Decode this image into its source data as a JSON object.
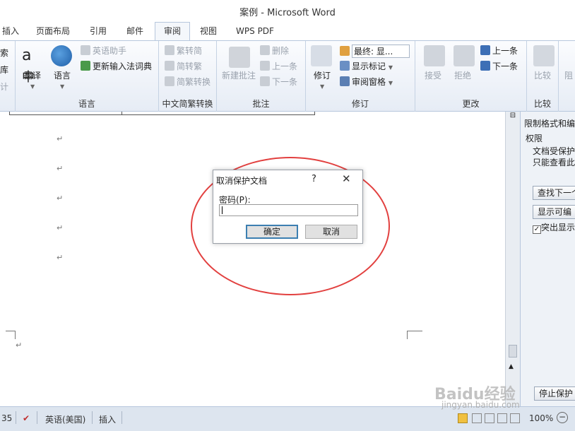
{
  "window": {
    "title": "案例 - Microsoft Word"
  },
  "tabs": [
    "插入",
    "页面布局",
    "引用",
    "邮件",
    "审阅",
    "视图",
    "WPS PDF"
  ],
  "active_tab": "审阅",
  "ribbon": {
    "left_partial": [
      "索",
      "库",
      "计"
    ],
    "language": {
      "label": "语言",
      "translate": "翻译",
      "language_btn": "语言",
      "english_assistant": "英语助手",
      "update_ime": "更新输入法词典"
    },
    "chinese_convert": {
      "label": "中文简繁转换",
      "to_traditional": "繁转简",
      "to_simplified": "简转繁",
      "convert": "简繁转换"
    },
    "comments": {
      "label": "批注",
      "new_comment": "新建批注",
      "delete": "删除",
      "previous": "上一条",
      "next": "下一条"
    },
    "tracking": {
      "label": "修订",
      "track_changes": "修订",
      "final_display": "最终: 显...",
      "show_markup": "显示标记",
      "reviewing_pane": "审阅窗格"
    },
    "changes": {
      "label": "更改",
      "accept": "接受",
      "reject": "拒绝",
      "previous": "上一条",
      "next": "下一条"
    },
    "compare": {
      "label": "比较",
      "compare_btn": "比较"
    },
    "protect_partial": "阻"
  },
  "side_pane": {
    "title": "限制格式和编辑",
    "section": "权限",
    "line1": "文档受保护",
    "line2": "只能查看此",
    "find_next": "查找下一个",
    "show_editable": "显示可编",
    "highlight": "突出显示",
    "stop_protection": "停止保护"
  },
  "dialog": {
    "title": "取消保护文档",
    "help": "?",
    "close": "✕",
    "password_label": "密码(P):",
    "password_value": "",
    "ok": "确定",
    "cancel": "取消"
  },
  "status": {
    "page_partial": "35",
    "language": "英语(美国)",
    "mode": "插入",
    "zoom": "100%"
  },
  "watermark": {
    "brand": "Baidu经验",
    "url": "jingyan.baidu.com"
  },
  "colors": {
    "annotation_circle": "#e2403f",
    "ribbon_border": "#b7c7dd"
  }
}
